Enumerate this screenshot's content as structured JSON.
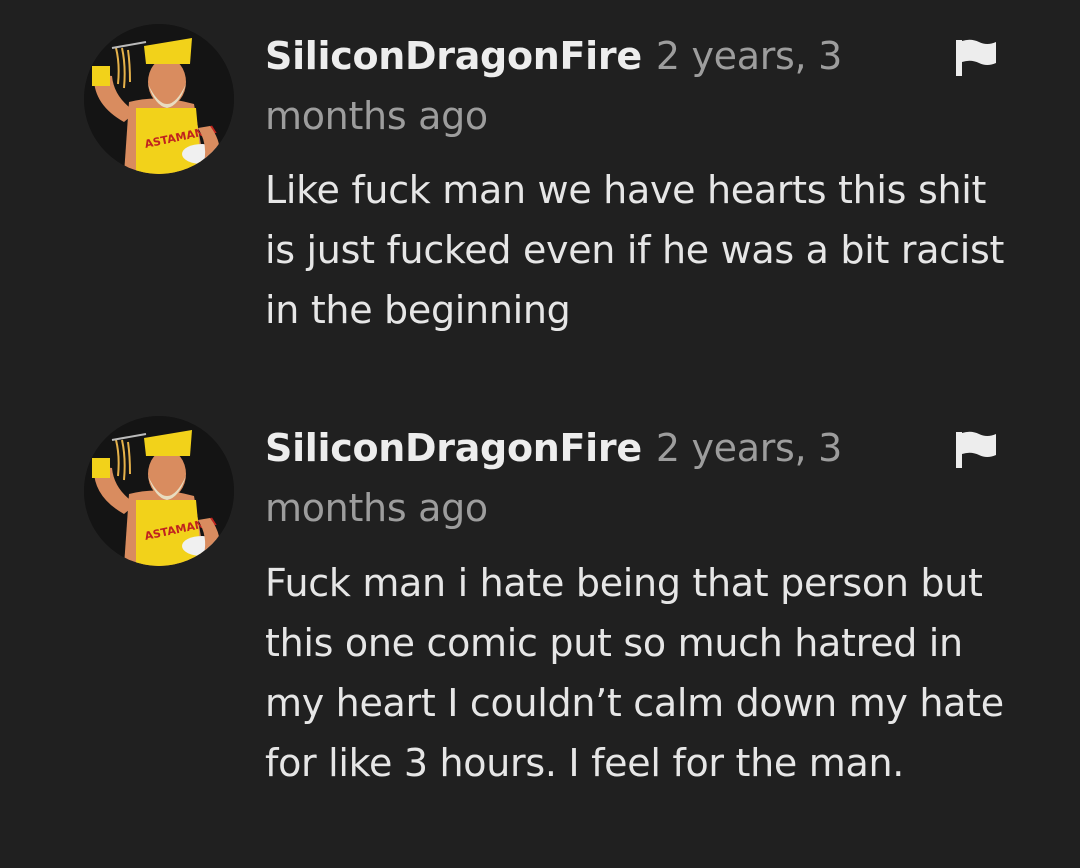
{
  "comments": [
    {
      "username": "SiliconDragonFire",
      "timestamp": "2 years, 3 months ago",
      "text": "Like fuck man we have hearts this shit is just fucked even if he was a bit racist in the beginning",
      "avatar_icon": "wrestler-avatar",
      "flag_icon": "flag-icon"
    },
    {
      "username": "SiliconDragonFire",
      "timestamp": "2 years, 3 months ago",
      "text": "Fuck man i hate being that person but this one comic put so much hatred in my heart I couldn’t calm down my hate for like 3 hours. I feel for the man.",
      "avatar_icon": "wrestler-avatar",
      "flag_icon": "flag-icon"
    }
  ],
  "colors": {
    "background": "#202020",
    "username": "#ededed",
    "timestamp": "#9d9d9d",
    "text": "#e6e6e6",
    "avatar_accent": "#f2d21a"
  }
}
